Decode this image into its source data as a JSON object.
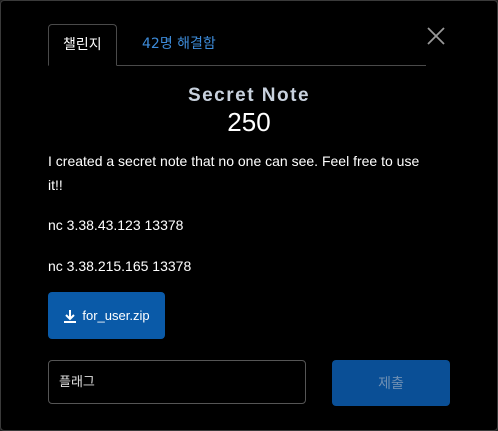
{
  "tabs": {
    "challenge_label": "챌린지",
    "solves_label": "42명 해결함"
  },
  "challenge": {
    "name": "Secret Note",
    "points": "250",
    "description": "I created a secret note that no one can see. Feel free to use it!!",
    "connections": [
      "nc 3.38.43.123 13378",
      "nc 3.38.215.165 13378"
    ]
  },
  "download": {
    "file_label": "for_user.zip",
    "icon": "download-icon"
  },
  "flag_form": {
    "placeholder": "플래그",
    "value": "",
    "submit_label": "제출"
  },
  "icons": {
    "close": "close-icon"
  },
  "colors": {
    "accent": "#0a5aa8",
    "link": "#3d8bd9",
    "title": "#c8d1dd"
  }
}
